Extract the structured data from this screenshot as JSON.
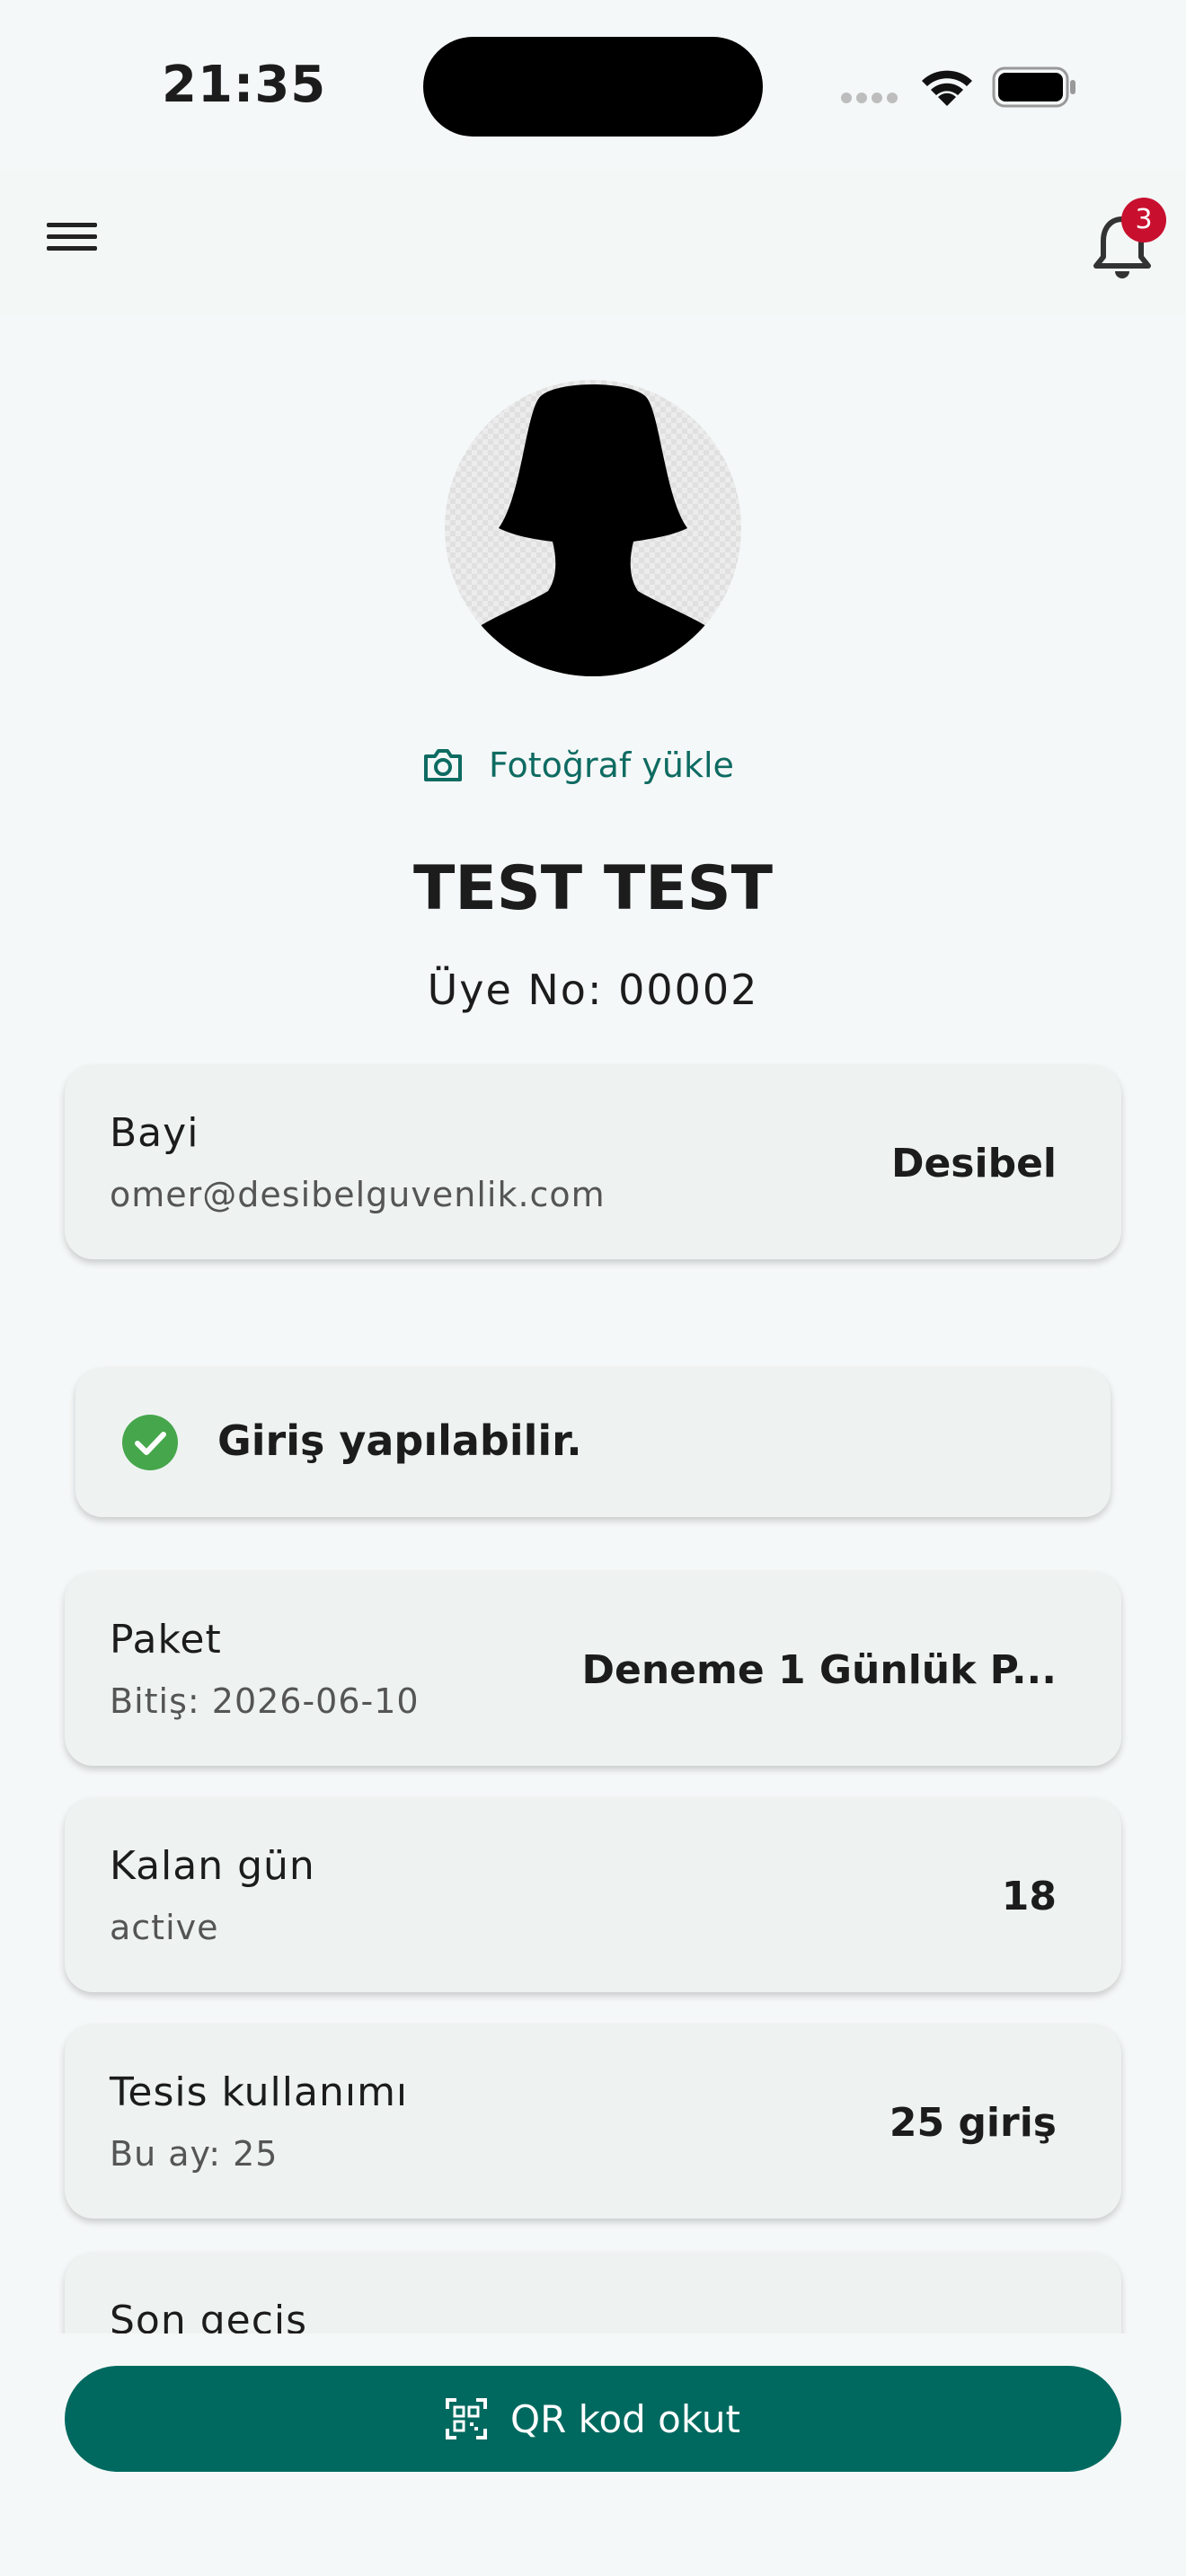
{
  "status_bar": {
    "time": "21:35"
  },
  "header": {
    "notification_count": "3"
  },
  "profile": {
    "upload_photo_label": "Fotoğraf yükle",
    "name": "TEST TEST",
    "member_no": "Üye No: 00002"
  },
  "dealer_card": {
    "title": "Bayi",
    "subtitle": "omer@desibelguvenlik.com",
    "value": "Desibel"
  },
  "entry_status": {
    "label": "Giriş yapılabilir."
  },
  "package_card": {
    "title": "Paket",
    "subtitle": "Bitiş: 2026-06-10",
    "value": "Deneme 1 Günlük P..."
  },
  "remaining_card": {
    "title": "Kalan gün",
    "subtitle": "active",
    "value": "18"
  },
  "usage_card": {
    "title": "Tesis kullanımı",
    "subtitle": "Bu ay: 25",
    "value": "25 giriş"
  },
  "last_pass_card": {
    "title": "Son geçiş"
  },
  "qr_button": {
    "label": "QR kod okut"
  },
  "colors": {
    "accent": "#00695f",
    "success": "#46a64b",
    "badge": "#c8102e"
  }
}
